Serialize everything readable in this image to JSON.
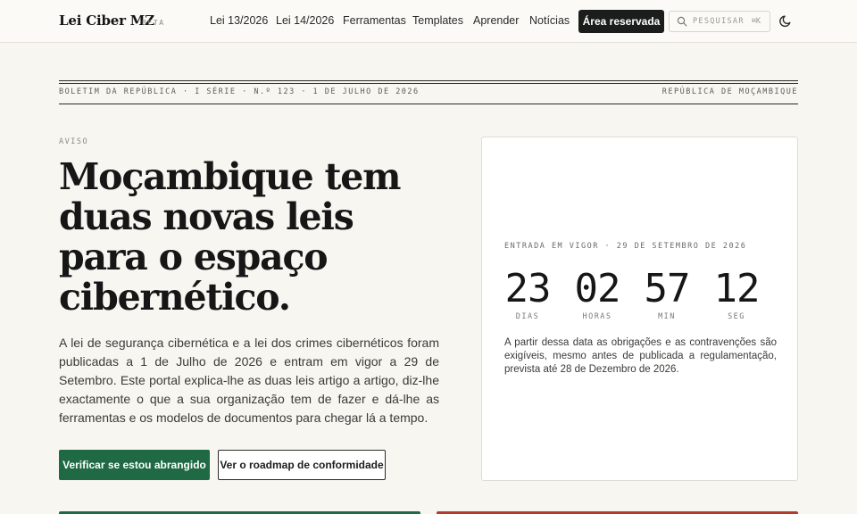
{
  "header": {
    "brand": "Lei Ciber MZ",
    "badge": "BETA",
    "nav": [
      {
        "label": "Lei 13/2026"
      },
      {
        "label": "Lei 14/2026"
      },
      {
        "label": "Ferramentas"
      },
      {
        "label": "Templates"
      },
      {
        "label": "Aprender"
      },
      {
        "label": "Notícias"
      }
    ],
    "reserved_label": "Área reservada",
    "search_placeholder": "PESQUISAR",
    "search_shortcut": "⌘K",
    "icons": {
      "search": "search-icon",
      "theme": "moon-icon"
    }
  },
  "bulletin": {
    "left": "BOLETIM DA REPÚBLICA · I SÉRIE · N.º 123 · 1 DE JULHO DE 2026",
    "right": "REPÚBLICA DE MOÇAMBIQUE"
  },
  "hero": {
    "eyebrow": "AVISO",
    "title": "Moçambique tem duas novas leis para o espaço cibernético.",
    "lead": "A lei de segurança cibernética e a lei dos crimes cibernéticos foram publicadas a 1 de Julho de 2026 e entram em vigor a 29 de Setembro. Este portal explica-lhe as duas leis artigo a artigo, diz-lhe exactamente o que a sua organização tem de fazer e dá-lhe as ferramentas e os modelos de documentos para chegar lá a tempo.",
    "primary_cta": "Verificar se estou abrangido",
    "secondary_cta": "Ver o roadmap de conformidade"
  },
  "countdown": {
    "label": "ENTRADA EM VIGOR · 29 DE SETEMBRO DE 2026",
    "units": [
      {
        "value": "23",
        "caption": "DIAS"
      },
      {
        "value": "02",
        "caption": "HORAS"
      },
      {
        "value": "57",
        "caption": "MIN"
      },
      {
        "value": "12",
        "caption": "SEG"
      }
    ],
    "note": "A partir dessa data as obrigações e as contravenções são exigíveis, mesmo antes de publicada a regulamentação, prevista até 28 de Dezembro de 2026."
  },
  "colors": {
    "accent_green": "#1f6a45",
    "accent_red": "#b33a2e",
    "background": "#f7f6f1",
    "ink": "#161616"
  }
}
